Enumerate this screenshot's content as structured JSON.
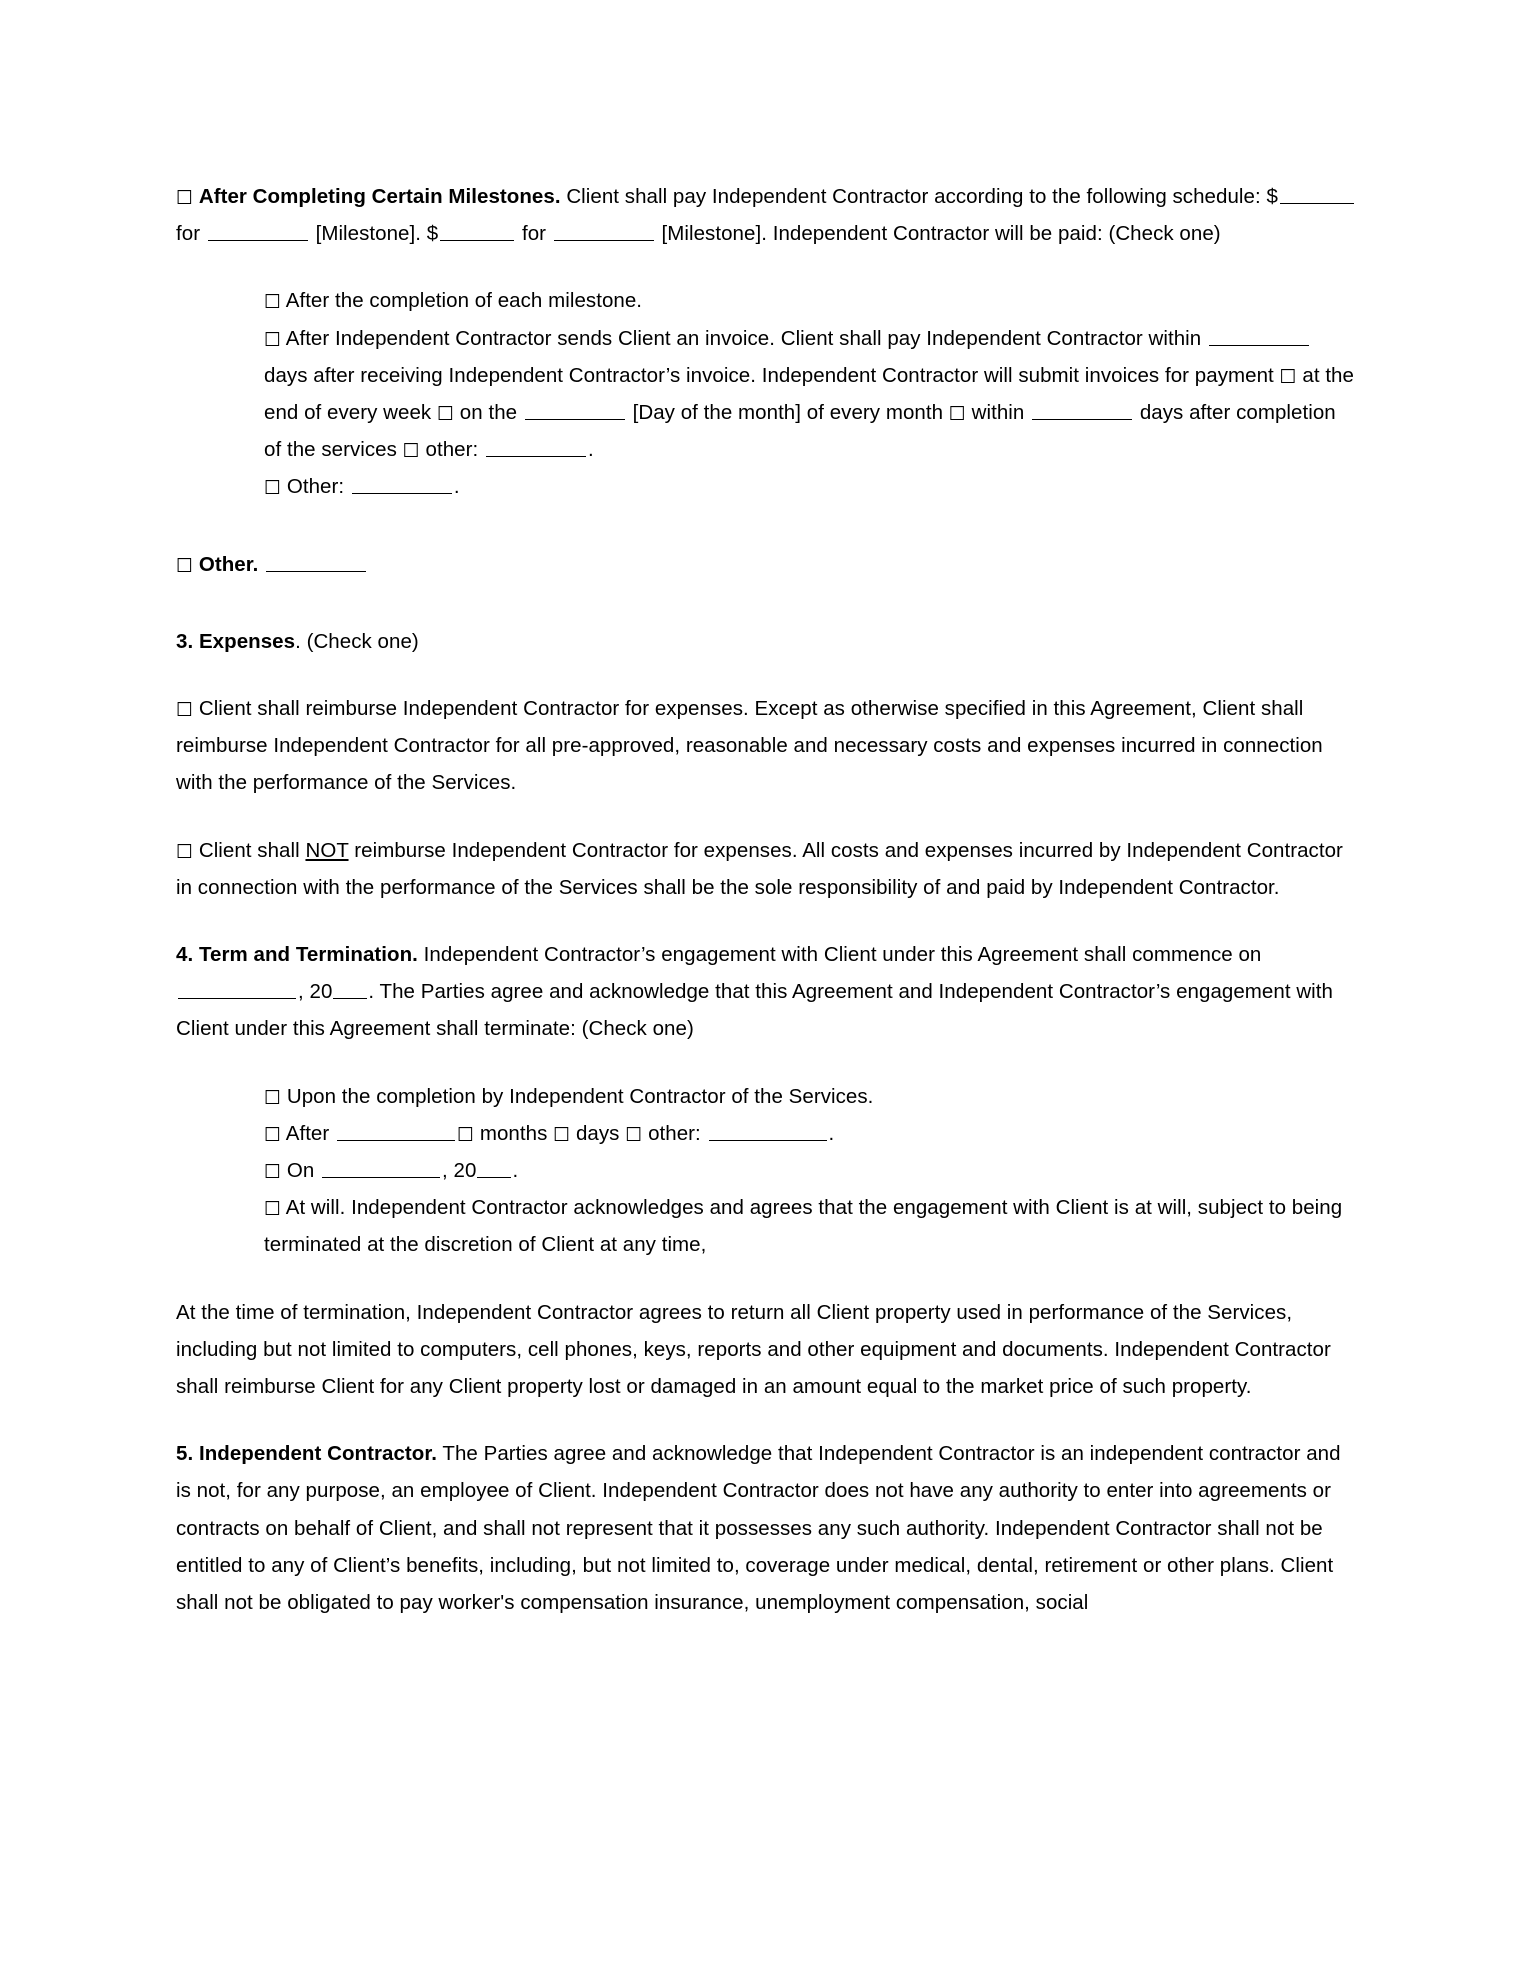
{
  "document": {
    "type": "independent-contractor-agreement",
    "sections": {
      "milestones": {
        "checkbox": "☐",
        "heading": "After Completing Certain Milestones.",
        "body_1": " Client shall pay Independent Contractor according to the following schedule: $",
        "body_2": " for ",
        "body_3": " [Milestone]. $",
        "body_4": " for ",
        "body_5": " [Milestone]. Independent Contractor will be paid: (Check one)",
        "options": {
          "opt1": "After the completion of each milestone.",
          "opt2_a": "After Independent Contractor sends Client an invoice. Client shall pay Independent Contractor within ",
          "opt2_b": " days after receiving Independent Contractor’s invoice. Independent Contractor will submit invoices for payment ",
          "opt2_c": " at the end of every week ",
          "opt2_d": " on the ",
          "opt2_e": " [Day of the month] of every month ",
          "opt2_f": " within ",
          "opt2_g": " days after completion of the services ",
          "opt2_h": " other: ",
          "opt2_i": ".",
          "opt3_label": "Other: ",
          "opt3_tail": "."
        }
      },
      "other": {
        "checkbox": "☐",
        "heading": "Other."
      },
      "expenses": {
        "number_title": "3. Expenses",
        "title_suffix": ". (Check one)",
        "option_reimburse": "Client shall reimburse Independent Contractor for expenses. Except as otherwise specified in this Agreement, Client shall reimburse Independent Contractor for all pre-approved, reasonable and necessary costs and expenses incurred in connection with the performance of the Services.",
        "option_not_a": "Client shall ",
        "option_not_underlined": "NOT",
        "option_not_b": " reimburse Independent Contractor for expenses. All costs and expenses incurred by Independent Contractor in connection with the performance of the Services shall be the sole responsibility of and paid by Independent Contractor."
      },
      "term": {
        "number_title": "4. Term and Termination.",
        "body_1": " Independent Contractor’s engagement with Client under this Agreement shall commence on ",
        "body_2": ", 20",
        "body_3": ". The Parties agree and acknowledge that this Agreement and Independent Contractor’s engagement with Client under this Agreement shall terminate: (Check one)",
        "options": {
          "opt1": "Upon the completion by Independent Contractor of the Services.",
          "opt2_a": "After ",
          "opt2_b": " months ",
          "opt2_c": " days ",
          "opt2_d": " other: ",
          "opt2_e": ".",
          "opt3_a": "On ",
          "opt3_b": ", 20",
          "opt3_c": ".",
          "opt4": "At will. Independent Contractor acknowledges and agrees that the engagement with Client is at will, subject to being terminated at the discretion of Client at any time,"
        },
        "closing_paragraph": "At the time of termination, Independent Contractor agrees to return all Client property used in performance of the Services, including but not limited to computers, cell phones, keys, reports and other equipment and documents. Independent Contractor shall reimburse Client for any Client property lost or damaged in an amount equal to the market price of such property."
      },
      "independent_contractor": {
        "number_title": "5. Independent Contractor.",
        "body": " The Parties agree and acknowledge that Independent Contractor is an independent contractor and is not, for any purpose, an employee of Client.  Independent Contractor does not have any authority to enter into agreements or contracts on behalf of Client, and shall not represent that it possesses any such authority. Independent Contractor shall not be entitled to any of Client’s benefits, including, but not limited to, coverage under medical, dental, retirement or other plans. Client shall not be obligated to pay worker's compensation insurance, unemployment compensation, social"
      }
    },
    "glyphs": {
      "checkbox_empty": "☐"
    }
  }
}
